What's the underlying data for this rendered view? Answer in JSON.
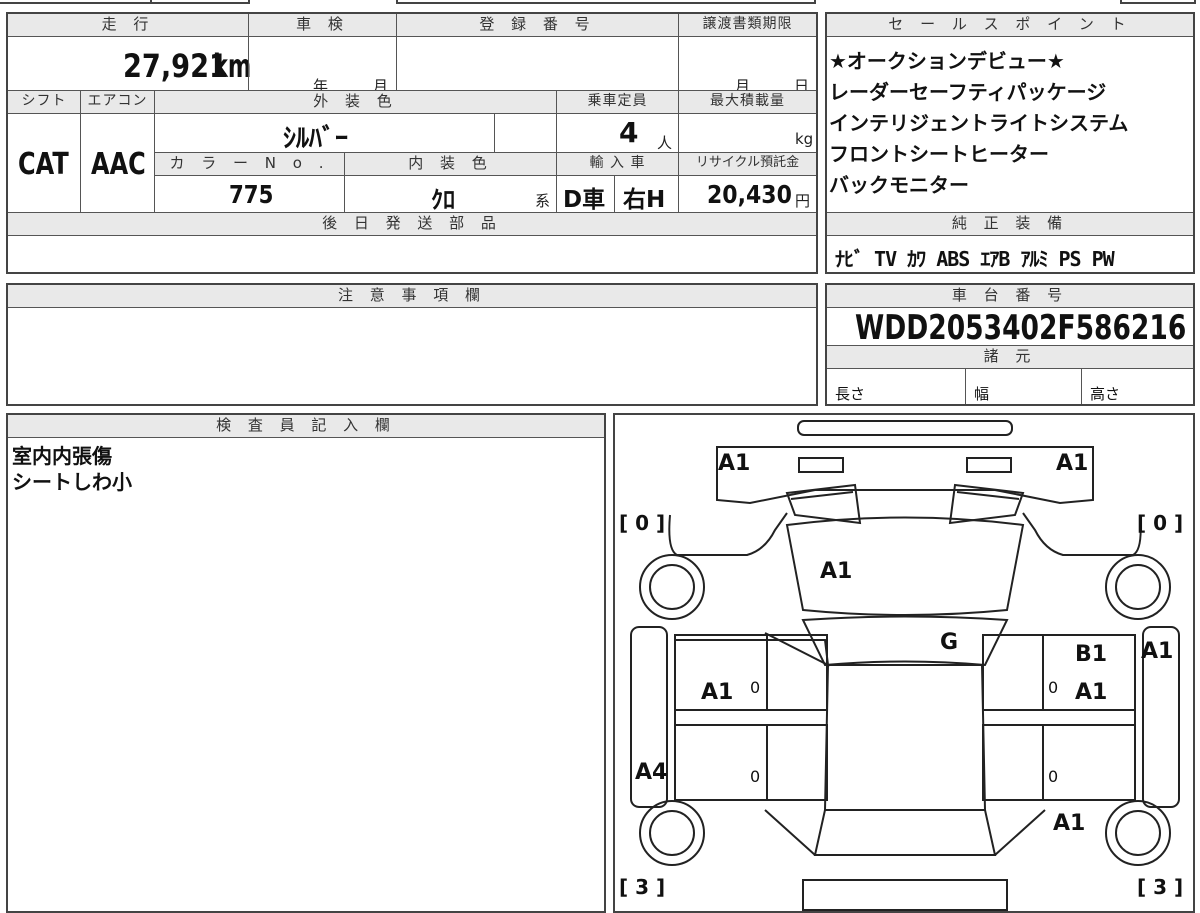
{
  "headers": {
    "mileage": "走 行",
    "inspection": "車 検",
    "registration": "登 録 番 号",
    "transfer_deadline": "譲渡書類期限",
    "shift": "シフト",
    "aircon": "エアコン",
    "exterior_color": "外 装 色",
    "capacity": "乗車定員",
    "max_load": "最大積載量",
    "color_no": "カ ラ ー N o .",
    "interior_color": "内 装 色",
    "import": "輸 入 車",
    "recycle": "リサイクル預託金",
    "later_parts": "後 日 発 送 部 品",
    "sales_points": "セ ー ル ス ポ イ ン ト",
    "genuine_equipment": "純 正 装 備",
    "notes": "注 意 事 項 欄",
    "chassis_number": "車 台 番 号",
    "specs": "諸 元",
    "inspector": "検 査 員 記 入 欄"
  },
  "values": {
    "mileage": "27,921",
    "mileage_unit": "km",
    "inspection_year": "年",
    "inspection_month": "月",
    "deadline_month": "月",
    "deadline_day": "日",
    "shift": "CAT",
    "aircon": "AAC",
    "exterior_color": "ｼﾙﾊﾞｰ",
    "capacity": "4",
    "capacity_unit": "人",
    "max_load_unit": "kg",
    "color_no": "775",
    "interior_color": "ｸﾛ",
    "interior_suffix": "系",
    "import_type": "D車",
    "steering": "右H",
    "recycle": "20,430",
    "recycle_unit": "円",
    "chassis_number": "WDD2053402F586216",
    "spec_length": "長さ",
    "spec_width": "幅",
    "spec_height": "高さ"
  },
  "sales_points": [
    "★オークションデビュー★",
    "レーダーセーフティパッケージ",
    "インテリジェントライトシステム",
    "フロントシートヒーター",
    "バックモニター"
  ],
  "equipment": "ﾅﾋﾞ TV ｶﾜ ABS ｴｱB ｱﾙﾐ PS PW",
  "inspector_notes": [
    "室内内張傷",
    "シートしわ小"
  ],
  "diagram": {
    "labels": {
      "front_left": "A1",
      "front_right": "A1",
      "hood": "A1",
      "windshield": "G",
      "left_front_door": "A1",
      "right_front_door_top": "B1",
      "right_front_door": "A1",
      "right_pillar": "A1",
      "left_rocker": "A4",
      "right_rear_fender": "A1"
    },
    "tire_marks": {
      "front_left": "[ 0 ]",
      "front_right": "[ 0 ]",
      "rear_left": "[ 3 ]",
      "rear_right": "[ 3 ]"
    },
    "zero_marks": [
      "0",
      "0",
      "0",
      "0"
    ]
  },
  "colors": {
    "border": "#444444",
    "header_bg": "#e9e9e9"
  }
}
